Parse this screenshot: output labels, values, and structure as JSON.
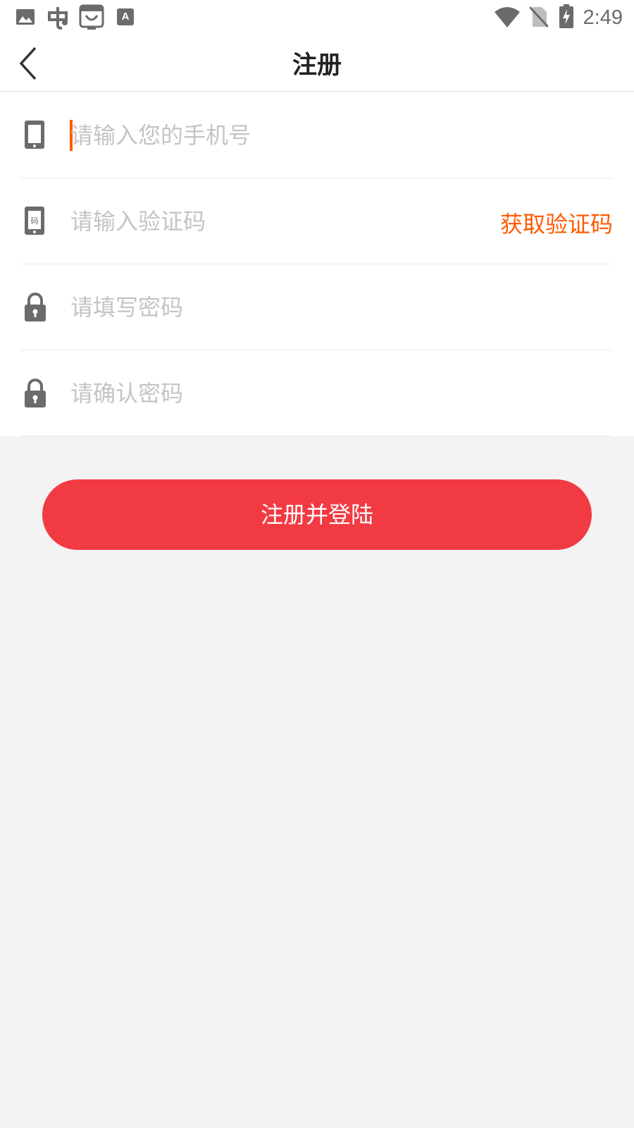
{
  "status_bar": {
    "time": "2:49",
    "left_icons": [
      "image-icon",
      "app-notification-icon",
      "shop-bag-icon",
      "font-icon"
    ],
    "right_icons": [
      "wifi-icon",
      "no-sim-icon",
      "battery-charging-icon"
    ]
  },
  "header": {
    "title": "注册",
    "back_icon": "chevron-left-icon"
  },
  "form": {
    "phone": {
      "placeholder": "请输入您的手机号",
      "icon": "phone-icon"
    },
    "code": {
      "placeholder": "请输入验证码",
      "icon": "phone-code-icon",
      "icon_label": "码",
      "get_code_label": "获取验证码"
    },
    "password": {
      "placeholder": "请填写密码",
      "icon": "lock-icon"
    },
    "confirm_password": {
      "placeholder": "请确认密码",
      "icon": "lock-icon"
    }
  },
  "submit_label": "注册并登陆",
  "colors": {
    "accent_orange": "#ff5a00",
    "button_red": "#f23a43",
    "background": "#f3f3f3",
    "icon_gray": "#6b6b6b",
    "placeholder_gray": "#c4c4c4"
  }
}
